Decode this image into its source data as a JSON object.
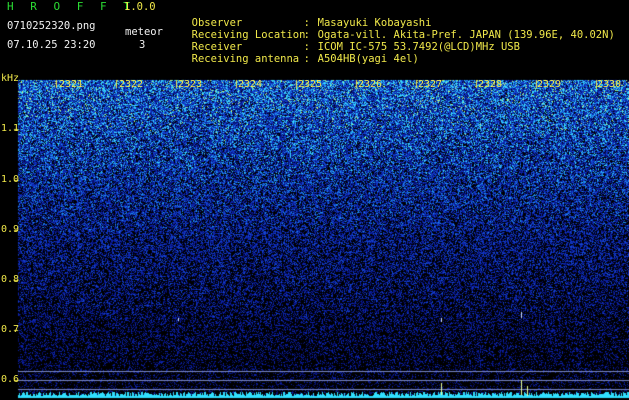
{
  "app": {
    "title": "H R O F F T",
    "version": "1.0.0",
    "filename": "0710252320.png",
    "timestamp": "07.10.25 23:20",
    "meteor_label": "meteor",
    "meteor_count": "3"
  },
  "info": [
    {
      "key": "Observer",
      "value": "Masayuki Kobayashi"
    },
    {
      "key": "Receiving Location",
      "value": "Ogata-vill. Akita-Pref. JAPAN (139.96E, 40.02N)"
    },
    {
      "key": "Receiver",
      "value": "ICOM IC-575 53.7492(@LCD)MHz USB"
    },
    {
      "key": "Receiving antenna",
      "value": "A504HB(yagi 4el)"
    }
  ],
  "axis": {
    "y_unit": "kHz",
    "y_ticks": [
      "1.1",
      "1.0",
      "0.9",
      "0.8",
      "0.7",
      "0.6"
    ],
    "x_ticks": [
      "2321",
      "2322",
      "2323",
      "2324",
      "2325",
      "2326",
      "2327",
      "2328",
      "2329",
      "2330"
    ]
  },
  "colors": {
    "background": "#000000",
    "label_yellow": "#f0e84a",
    "title_green": "#2bdc33",
    "noise_deep": "#0a1aa8",
    "noise_bright": "#3dd6ff",
    "baseline_cyan": "#30e0ff"
  }
}
